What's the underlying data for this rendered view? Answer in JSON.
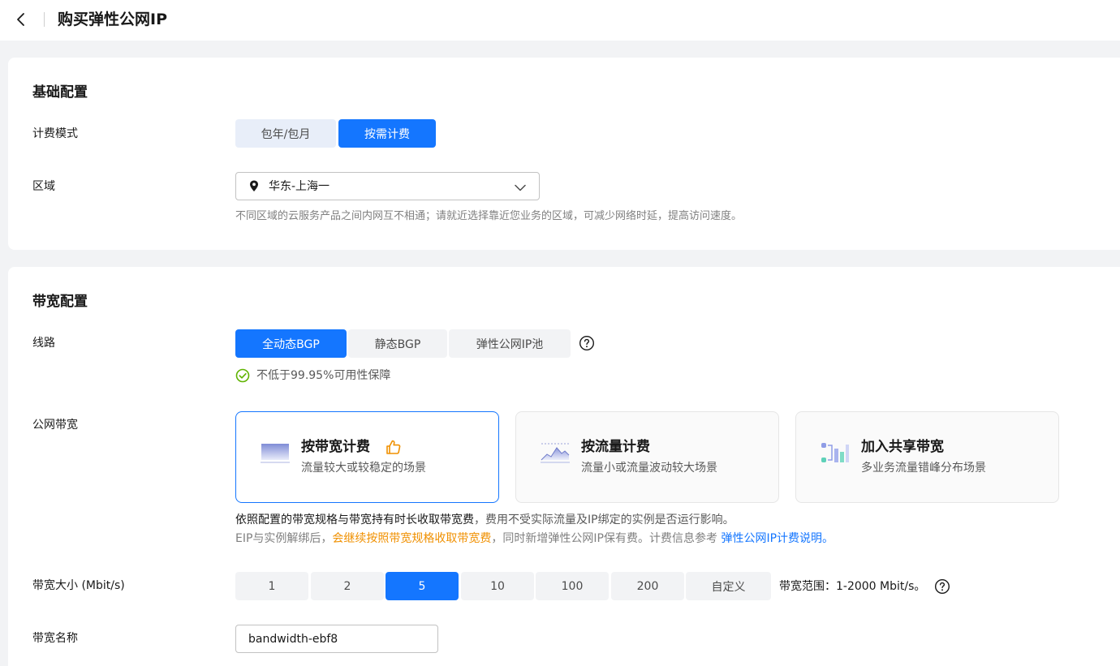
{
  "header": {
    "title": "购买弹性公网IP"
  },
  "basic": {
    "title": "基础配置",
    "billing_label": "计费模式",
    "billing_options": [
      {
        "label": "包年/包月",
        "selected": false
      },
      {
        "label": "按需计费",
        "selected": true
      }
    ],
    "region_label": "区域",
    "region_value": "华东-上海一",
    "region_hint": "不同区域的云服务产品之间内网互不相通；请就近选择靠近您业务的区域，可减少网络时延，提高访问速度。"
  },
  "bandwidth": {
    "title": "带宽配置",
    "line_label": "线路",
    "line_options": [
      {
        "label": "全动态BGP",
        "selected": true
      },
      {
        "label": "静态BGP",
        "selected": false
      },
      {
        "label": "弹性公网IP池",
        "selected": false
      }
    ],
    "availability": "不低于99.95%可用性保障",
    "public_label": "公网带宽",
    "billing_cards": [
      {
        "title": "按带宽计费",
        "subtitle": "流量较大或较稳定的场景",
        "selected": true,
        "recommended": true
      },
      {
        "title": "按流量计费",
        "subtitle": "流量小或流量波动较大场景",
        "selected": false
      },
      {
        "title": "加入共享带宽",
        "subtitle": "多业务流量错峰分布场景",
        "selected": false
      }
    ],
    "desc_main": "依照配置的带宽规格与带宽持有时长收取带宽费",
    "desc_rest": "，费用不受实际流量及IP绑定的实例是否运行影响。",
    "desc2_a": "EIP与实例解绑后，",
    "desc2_orange": "会继续按照带宽规格收取带宽费",
    "desc2_b": "，同时新增弹性公网IP保有费。计费信息参考 ",
    "desc2_link": "弹性公网IP计费说明。",
    "size_label": "带宽大小 (Mbit/s)",
    "sizes": [
      "1",
      "2",
      "5",
      "10",
      "100",
      "200",
      "自定义"
    ],
    "selected_size": "5",
    "range": "带宽范围：1-2000 Mbit/s。",
    "name_label": "带宽名称",
    "name_value": "bandwidth-ebf8"
  },
  "colors": {
    "primary": "#1476ff",
    "accent_orange": "#f09000",
    "success_green": "#5fb300"
  }
}
